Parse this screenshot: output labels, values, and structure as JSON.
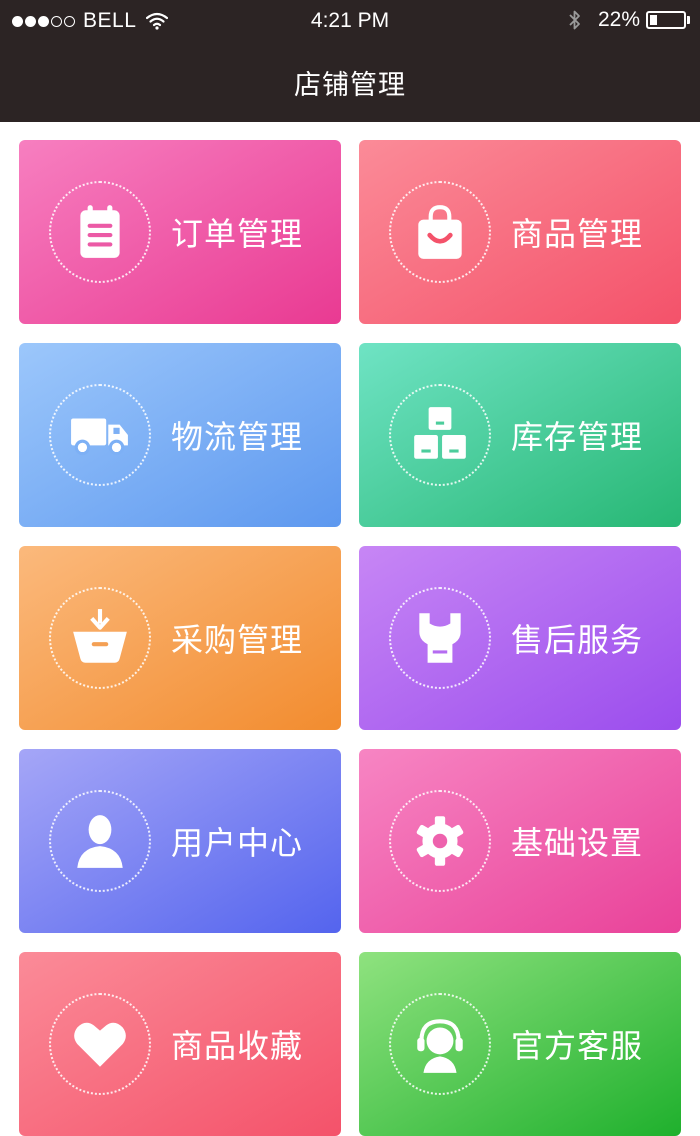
{
  "status_bar": {
    "carrier": "BELL",
    "time": "4:21 PM",
    "battery": "22%",
    "battery_level": 0.22
  },
  "header": {
    "title": "店铺管理"
  },
  "tiles": [
    {
      "label": "订单管理",
      "icon": "clipboard-icon",
      "gradient": [
        "#f77fc0",
        "#e93a92"
      ]
    },
    {
      "label": "商品管理",
      "icon": "shopping-bag-icon",
      "gradient": [
        "#fb8b98",
        "#f4526a"
      ]
    },
    {
      "label": "物流管理",
      "icon": "truck-icon",
      "gradient": [
        "#9cc7fb",
        "#5d98ef"
      ]
    },
    {
      "label": "库存管理",
      "icon": "boxes-icon",
      "gradient": [
        "#6fe3c4",
        "#27b774"
      ]
    },
    {
      "label": "采购管理",
      "icon": "basket-icon",
      "gradient": [
        "#fbb97c",
        "#f28c2f"
      ]
    },
    {
      "label": "售后服务",
      "icon": "wrench-icon",
      "gradient": [
        "#c786f5",
        "#9b4ded"
      ]
    },
    {
      "label": "用户中心",
      "icon": "user-icon",
      "gradient": [
        "#a5a6f7",
        "#5464ee"
      ]
    },
    {
      "label": "基础设置",
      "icon": "gear-icon",
      "gradient": [
        "#f785c3",
        "#e94299"
      ]
    },
    {
      "label": "商品收藏",
      "icon": "heart-icon",
      "gradient": [
        "#fb8b98",
        "#f4526a"
      ]
    },
    {
      "label": "官方客服",
      "icon": "headset-icon",
      "gradient": [
        "#8fe27f",
        "#1fb02d"
      ]
    }
  ]
}
